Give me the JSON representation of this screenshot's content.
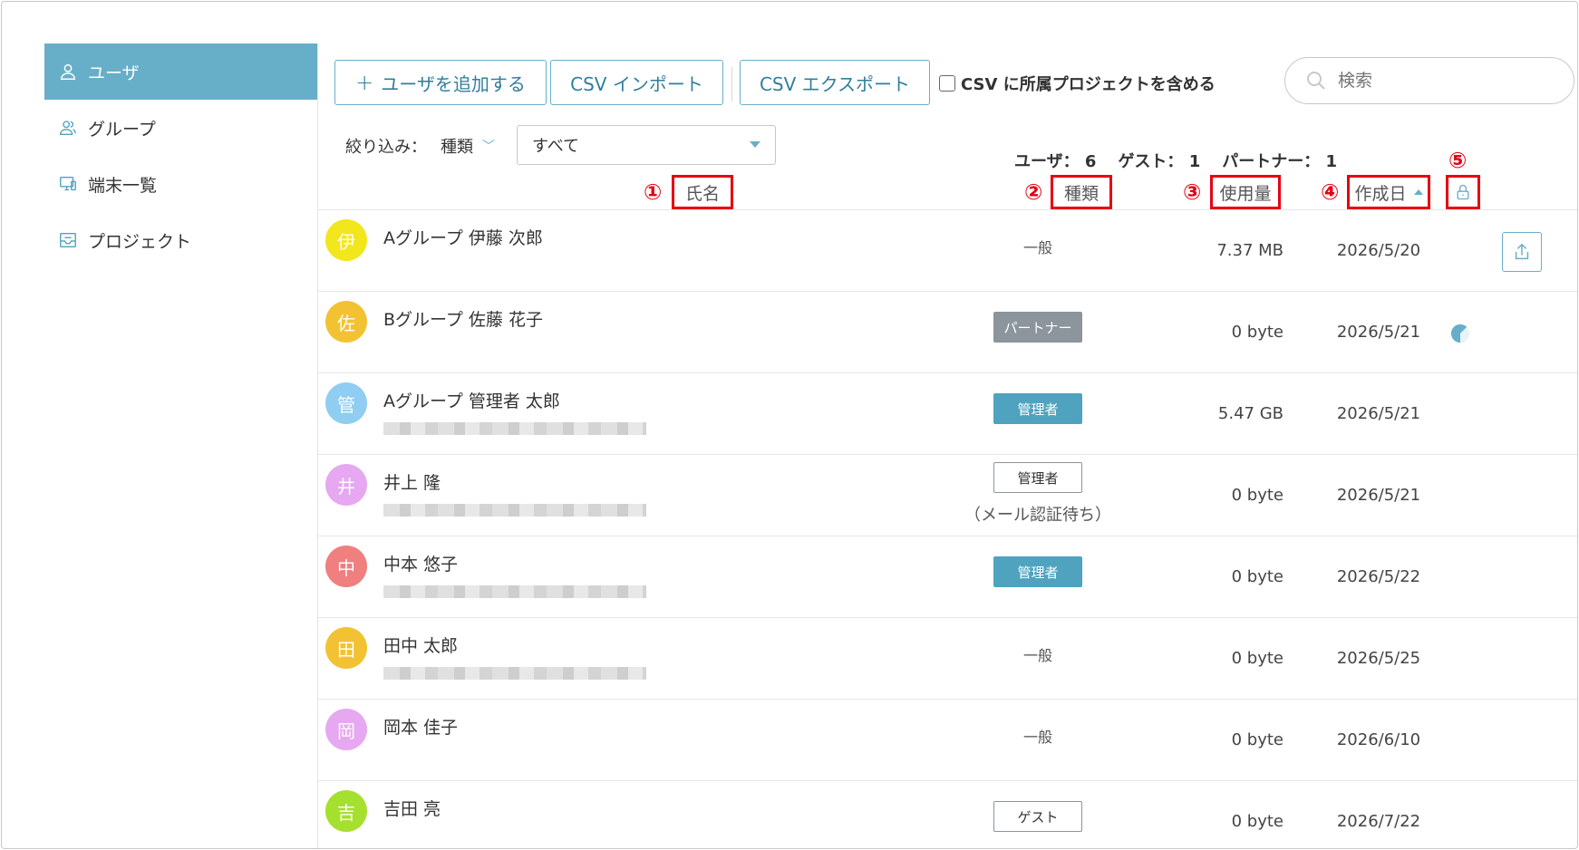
{
  "sidebar": {
    "items": [
      {
        "label": "ユーザ",
        "icon": "user-icon",
        "active": true
      },
      {
        "label": "グループ",
        "icon": "group-icon",
        "active": false
      },
      {
        "label": "端末一覧",
        "icon": "device-icon",
        "active": false
      },
      {
        "label": "プロジェクト",
        "icon": "project-icon",
        "active": false
      }
    ]
  },
  "toolbar": {
    "add_user_label": "ユーザを追加する",
    "csv_import_label": "CSV インポート",
    "csv_export_label": "CSV エクスポート",
    "include_projects_label": "CSV に所属プロジェクトを含める",
    "search_placeholder": "検索"
  },
  "filter": {
    "label": "絞り込み：",
    "type_label": "種類",
    "selected": "すべて"
  },
  "counts": {
    "users": "ユーザ： 6",
    "guests": "ゲスト： 1",
    "partners": "パートナー： 1"
  },
  "columns": {
    "name": "氏名",
    "type": "種類",
    "usage": "使用量",
    "created": "作成日",
    "markers": [
      "①",
      "②",
      "③",
      "④",
      "⑤"
    ]
  },
  "rows": [
    {
      "avatar": "伊",
      "color": "#f2e61c",
      "name": "Aグループ 伊藤 次郎",
      "type": "一般",
      "badge": "plain",
      "note": "",
      "usage": "7.37 MB",
      "created": "2026/5/20",
      "pie": false,
      "share": true,
      "blur": false
    },
    {
      "avatar": "佐",
      "color": "#f2c233",
      "name": "Bグループ 佐藤 花子",
      "type": "パートナー",
      "badge": "partner",
      "note": "",
      "usage": "0 byte",
      "created": "2026/5/21",
      "pie": true,
      "share": false,
      "blur": false
    },
    {
      "avatar": "管",
      "color": "#8fcdf2",
      "name": "Aグループ 管理者 太郎",
      "type": "管理者",
      "badge": "admin",
      "note": "",
      "usage": "5.47 GB",
      "created": "2026/5/21",
      "pie": false,
      "share": false,
      "blur": true
    },
    {
      "avatar": "井",
      "color": "#e6a8f0",
      "name": "井上 隆",
      "type": "管理者",
      "badge": "outline",
      "note": "（メール認証待ち）",
      "usage": "0 byte",
      "created": "2026/5/21",
      "pie": false,
      "share": false,
      "blur": true
    },
    {
      "avatar": "中",
      "color": "#f07f7f",
      "name": "中本 悠子",
      "type": "管理者",
      "badge": "admin",
      "note": "",
      "usage": "0 byte",
      "created": "2026/5/22",
      "pie": false,
      "share": false,
      "blur": true
    },
    {
      "avatar": "田",
      "color": "#f2c233",
      "name": "田中 太郎",
      "type": "一般",
      "badge": "plain",
      "note": "",
      "usage": "0 byte",
      "created": "2026/5/25",
      "pie": false,
      "share": false,
      "blur": true
    },
    {
      "avatar": "岡",
      "color": "#e6a8f0",
      "name": "岡本 佳子",
      "type": "一般",
      "badge": "plain",
      "note": "",
      "usage": "0 byte",
      "created": "2026/6/10",
      "pie": false,
      "share": false,
      "blur": false
    },
    {
      "avatar": "吉",
      "color": "#a6e02e",
      "name": "吉田 亮",
      "type": "ゲスト",
      "badge": "outline",
      "note": "",
      "usage": "0 byte",
      "created": "2026/7/22",
      "pie": false,
      "share": false,
      "blur": false
    }
  ],
  "colors": {
    "accent": "#67afc8",
    "highlight": "#e60012"
  }
}
